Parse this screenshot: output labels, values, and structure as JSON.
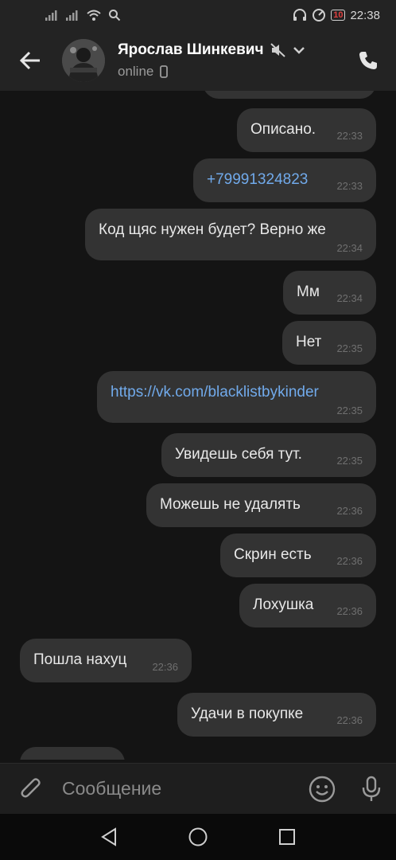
{
  "status_bar": {
    "time": "22:38",
    "battery": "10"
  },
  "header": {
    "name": "Ярослав Шинкевич",
    "status": "online"
  },
  "messages": [
    {
      "text": "Описано.",
      "time": "22:33",
      "outgoing": true
    },
    {
      "text": "+79991324823",
      "time": "22:33",
      "outgoing": true,
      "link": true
    },
    {
      "text": "Код щяс нужен будет? Верно же",
      "time": "22:34",
      "outgoing": true
    },
    {
      "text": "Мм",
      "time": "22:34",
      "outgoing": true
    },
    {
      "text": "Нет",
      "time": "22:35",
      "outgoing": true
    },
    {
      "text": "https://vk.com/blacklistbykinder",
      "time": "22:35",
      "outgoing": true,
      "link": true
    },
    {
      "text": "Увидешь себя тут.",
      "time": "22:35",
      "outgoing": true
    },
    {
      "text": "Можешь не удалять",
      "time": "22:36",
      "outgoing": true
    },
    {
      "text": "Скрин есть",
      "time": "22:36",
      "outgoing": true
    },
    {
      "text": "Лохушка",
      "time": "22:36",
      "outgoing": true
    },
    {
      "text": "Пошла нахуц",
      "time": "22:36",
      "outgoing": false
    },
    {
      "text": "Удачи в покупке",
      "time": "22:36",
      "outgoing": true
    }
  ],
  "composer": {
    "placeholder": "Сообщение"
  },
  "colors": {
    "bubble": "#333333",
    "link": "#71aaeb",
    "header": "#232323",
    "background": "#141414"
  }
}
